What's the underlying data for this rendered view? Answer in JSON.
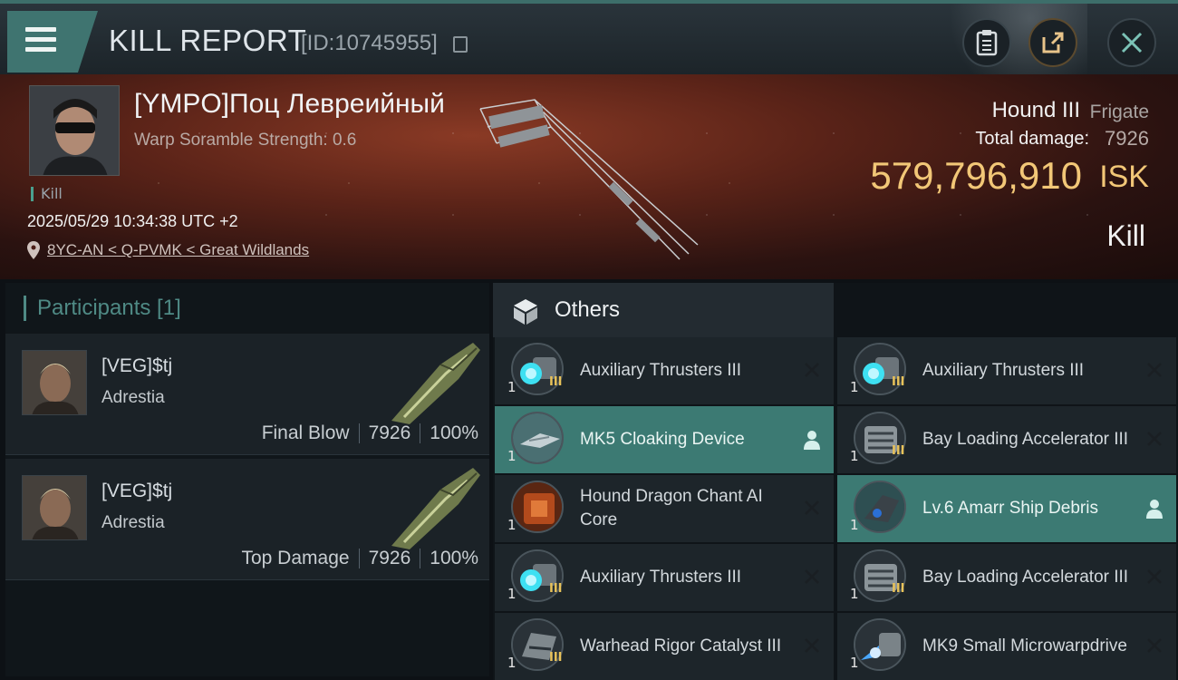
{
  "header": {
    "title": "KILL REPORT",
    "report_id": "[ID:10745955]"
  },
  "victim": {
    "name": "[YMPO]Поц Левреийный",
    "subtitle": "Warp Soramble Strength: 0.6",
    "kill_tag": "Kill",
    "timestamp": "2025/05/29 10:34:38 UTC +2",
    "location": "8YC-AN < Q-PVMK < Great Wildlands"
  },
  "ship": {
    "name": "Hound III",
    "class": "Frigate",
    "damage_label": "Total damage:",
    "damage_value": "7926",
    "isk_value": "579,796,910",
    "isk_unit": "ISK",
    "kill_type": "Kill"
  },
  "participants": {
    "header": "Participants [1]",
    "rows": [
      {
        "name": "[VEG]$tj",
        "corp": "Adrestia",
        "role": "Final Blow",
        "damage": "7926",
        "percent": "100%"
      },
      {
        "name": "[VEG]$tj",
        "corp": "Adrestia",
        "role": "Top Damage",
        "damage": "7926",
        "percent": "100%"
      }
    ]
  },
  "others": {
    "title": "Others",
    "items": [
      {
        "label": "Auxiliary Thrusters III",
        "qty": "1",
        "tier": "III",
        "icon": "thruster-icon",
        "highlighted": false
      },
      {
        "label": "Auxiliary Thrusters III",
        "qty": "1",
        "tier": "III",
        "icon": "thruster-icon",
        "highlighted": false
      },
      {
        "label": "MK5 Cloaking Device",
        "qty": "1",
        "tier": "",
        "icon": "cloak-icon",
        "highlighted": true
      },
      {
        "label": "Bay Loading Accelerator III",
        "qty": "1",
        "tier": "III",
        "icon": "accelerator-icon",
        "highlighted": false
      },
      {
        "label": "Hound Dragon Chant AI Core",
        "qty": "1",
        "tier": "",
        "icon": "ai-core-icon",
        "highlighted": false
      },
      {
        "label": "Lv.6 Amarr Ship Debris",
        "qty": "1",
        "tier": "",
        "icon": "debris-icon",
        "highlighted": true
      },
      {
        "label": "Auxiliary Thrusters III",
        "qty": "1",
        "tier": "III",
        "icon": "thruster-icon",
        "highlighted": false
      },
      {
        "label": "Bay Loading Accelerator III",
        "qty": "1",
        "tier": "III",
        "icon": "accelerator-icon",
        "highlighted": false
      },
      {
        "label": "Warhead Rigor Catalyst III",
        "qty": "1",
        "tier": "III",
        "icon": "catalyst-icon",
        "highlighted": false
      },
      {
        "label": "MK9 Small Microwarpdrive",
        "qty": "1",
        "tier": "",
        "icon": "microwarpdrive-icon",
        "highlighted": false
      }
    ]
  },
  "colors": {
    "accent": "#3f7470",
    "isk": "#f2c777",
    "highlight_row": "#3c7a73"
  }
}
